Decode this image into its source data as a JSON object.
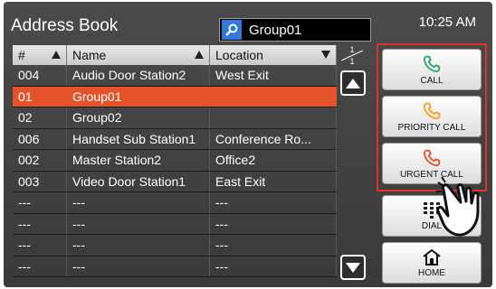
{
  "header": {
    "title": "Address Book",
    "search_value": "Group01",
    "time": "10:25 AM"
  },
  "table": {
    "columns": [
      "#",
      "Name",
      "Location"
    ],
    "rows": [
      [
        "004",
        "Audio Door Station2",
        "West Exit"
      ],
      [
        "01",
        "Group01",
        ""
      ],
      [
        "02",
        "Group02",
        ""
      ],
      [
        "006",
        "Handset Sub Station1",
        "Conference Ro..."
      ],
      [
        "002",
        "Master Station2",
        "Office2"
      ],
      [
        "003",
        "Video Door Station1",
        "East Exit"
      ],
      [
        "---",
        "---",
        "---"
      ],
      [
        "---",
        "---",
        "---"
      ],
      [
        "---",
        "---",
        "---"
      ],
      [
        "---",
        "---",
        "---"
      ]
    ],
    "selected_row": 1
  },
  "pager": {
    "current": "1",
    "total": "1"
  },
  "buttons": {
    "call": "CALL",
    "priority_call": "PRIORITY CALL",
    "urgent_call": "URGENT CALL",
    "dial": "DIAL",
    "home": "HOME"
  },
  "colors": {
    "selection": "#e4532b",
    "call_icon": "#2aa36b",
    "priority_icon": "#f0a020",
    "urgent_icon": "#e0532b",
    "highlight_box": "#e03030"
  }
}
